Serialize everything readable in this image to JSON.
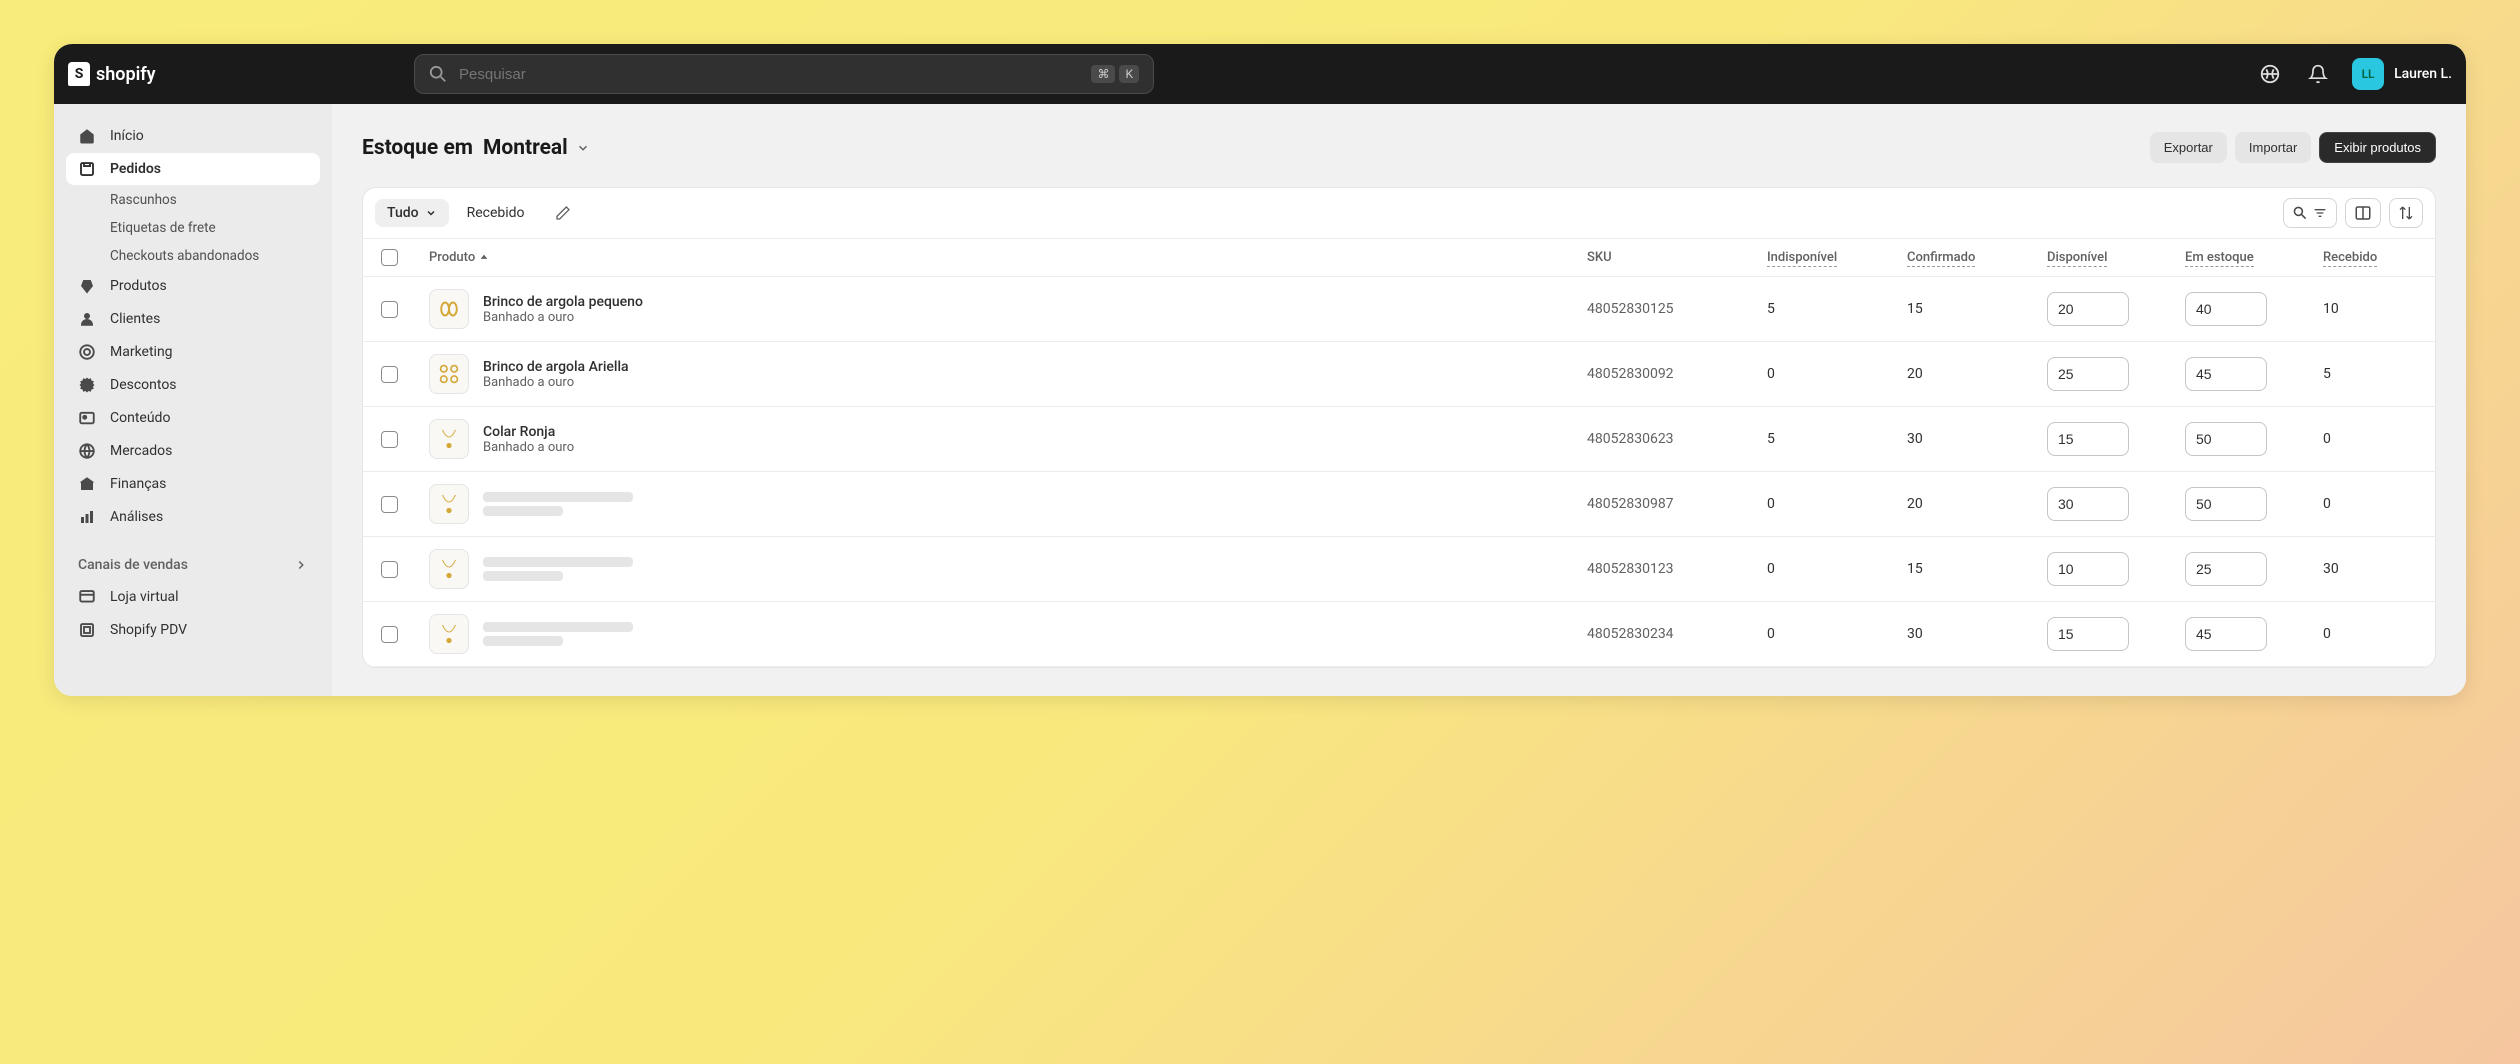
{
  "brand": "shopify",
  "search": {
    "placeholder": "Pesquisar",
    "shortcut_cmd": "⌘",
    "shortcut_key": "K"
  },
  "user": {
    "initials": "LL",
    "name": "Lauren L."
  },
  "sidebar": {
    "items": [
      {
        "label": "Início"
      },
      {
        "label": "Pedidos"
      },
      {
        "label": "Produtos"
      },
      {
        "label": "Clientes"
      },
      {
        "label": "Marketing"
      },
      {
        "label": "Descontos"
      },
      {
        "label": "Conteúdo"
      },
      {
        "label": "Mercados"
      },
      {
        "label": "Finanças"
      },
      {
        "label": "Análises"
      }
    ],
    "sub_orders": [
      {
        "label": "Rascunhos"
      },
      {
        "label": "Etiquetas de frete"
      },
      {
        "label": "Checkouts abandonados"
      }
    ],
    "channels_title": "Canais de vendas",
    "channels": [
      {
        "label": "Loja virtual"
      },
      {
        "label": "Shopify PDV"
      }
    ]
  },
  "page": {
    "title_prefix": "Estoque em",
    "location": "Montreal",
    "actions": {
      "export": "Exportar",
      "import": "Importar",
      "view_products": "Exibir produtos"
    }
  },
  "tabs": {
    "all": "Tudo",
    "received": "Recebido"
  },
  "columns": {
    "product": "Produto",
    "sku": "SKU",
    "unavailable": "Indisponível",
    "committed": "Confirmado",
    "available": "Disponível",
    "onhand": "Em estoque",
    "received": "Recebido"
  },
  "rows": [
    {
      "name": "Brinco de argola pequeno",
      "variant": "Banhado a ouro",
      "sku": "48052830125",
      "unavailable": "5",
      "committed": "15",
      "available": "20",
      "onhand": "40",
      "received": "10",
      "thumb": "hoops-small"
    },
    {
      "name": "Brinco de argola Ariella",
      "variant": "Banhado a ouro",
      "sku": "48052830092",
      "unavailable": "0",
      "committed": "20",
      "available": "25",
      "onhand": "45",
      "received": "5",
      "thumb": "hoops-triple"
    },
    {
      "name": "Colar Ronja",
      "variant": "Banhado a ouro",
      "sku": "48052830623",
      "unavailable": "5",
      "committed": "30",
      "available": "15",
      "onhand": "50",
      "received": "0",
      "thumb": "necklace"
    },
    {
      "name": "",
      "variant": "",
      "sku": "48052830987",
      "unavailable": "0",
      "committed": "20",
      "available": "30",
      "onhand": "50",
      "received": "0",
      "thumb": "necklace",
      "skeleton": true
    },
    {
      "name": "",
      "variant": "",
      "sku": "48052830123",
      "unavailable": "0",
      "committed": "15",
      "available": "10",
      "onhand": "25",
      "received": "30",
      "thumb": "necklace",
      "skeleton": true
    },
    {
      "name": "",
      "variant": "",
      "sku": "48052830234",
      "unavailable": "0",
      "committed": "30",
      "available": "15",
      "onhand": "45",
      "received": "0",
      "thumb": "necklace",
      "skeleton": true
    }
  ]
}
